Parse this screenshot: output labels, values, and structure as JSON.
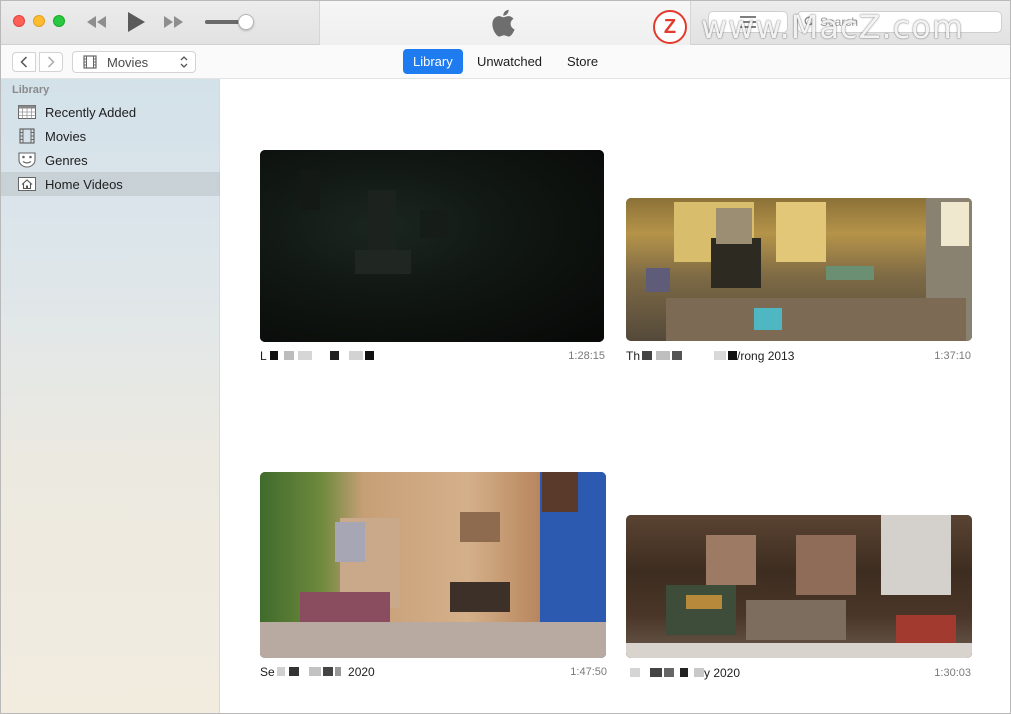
{
  "toolbar": {
    "search_placeholder": "Search"
  },
  "watermark": {
    "logo_letter": "Z",
    "text": "www.MacZ.com"
  },
  "nav": {
    "media_kind": "Movies",
    "tabs": [
      "Library",
      "Unwatched",
      "Store"
    ],
    "selected_tab": "Library"
  },
  "sidebar": {
    "heading": "Library",
    "items": [
      {
        "label": "Recently Added",
        "icon": "calendar-grid-icon"
      },
      {
        "label": "Movies",
        "icon": "film-icon"
      },
      {
        "label": "Genres",
        "icon": "theater-masks-icon"
      },
      {
        "label": "Home Videos",
        "icon": "house-icon"
      }
    ],
    "selected": "Home Videos"
  },
  "videos": [
    {
      "title": "L",
      "duration": "1:28:15"
    },
    {
      "title": "Th /rong 2013",
      "duration": "1:37:10"
    },
    {
      "title": "Se 2020",
      "duration": "1:47:50"
    },
    {
      "title": "y 2020",
      "duration": "1:30:03"
    }
  ],
  "title_parts": {
    "v1_a": "L",
    "v2_a": "Th",
    "v2_b": "/rong 2013",
    "v3_a": "Se",
    "v3_b": "2020",
    "v4_b": "y 2020"
  },
  "colors": {
    "accent": "#1f7cf0",
    "close": "#fe5f57",
    "minimize": "#febc2e",
    "zoom": "#28c840"
  }
}
